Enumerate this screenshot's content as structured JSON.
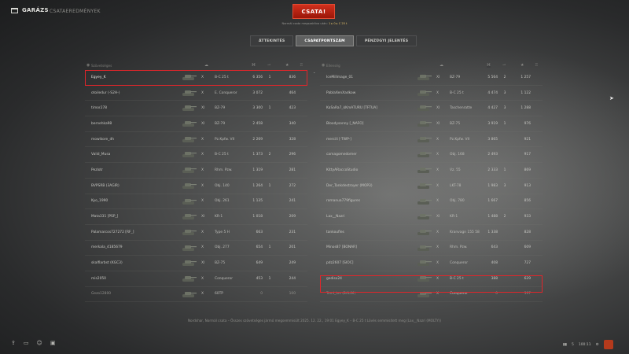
{
  "nav": {
    "garage_label": "GARÁZS",
    "battles_label": "CSATAEREDMÉNYEK"
  },
  "battle_button": "CSATA!",
  "subinfo": {
    "prefix": "Normál csata megszakítva után:",
    "value": "1 ▸ 0 ▸ C 25 t"
  },
  "tabs": [
    "ÁTTEKINTÉS",
    "CSAPATPONTSZÁM",
    "PÉNZÜGYI JELENTÉS"
  ],
  "active_tab": "CSAPATPONTSZÁM",
  "left_team": {
    "header": "Szövetséges",
    "rows": [
      {
        "player": "Egyey_K",
        "tier": "X",
        "tank": "B-C 25 t",
        "c1": "6 356",
        "c2": "1",
        "c3": "836",
        "self": true
      },
      {
        "player": "otoiledur (-S2H-)",
        "tier": "X",
        "tank": "E. Conqueror",
        "c1": "3 072",
        "c2": "",
        "c3": "464"
      },
      {
        "player": "timor278",
        "tier": "XI",
        "tank": "BZ-79",
        "c1": "3 300",
        "c2": "1",
        "c3": "423"
      },
      {
        "player": "bernehka98",
        "tier": "XI",
        "tank": "BZ-79",
        "c1": "2 458",
        "c2": "",
        "c3": "340"
      },
      {
        "player": "mowikore_dh",
        "tier": "X",
        "tank": "Pz.Kpfw. VII",
        "c1": "2 269",
        "c2": "",
        "c3": "328"
      },
      {
        "player": "Valid_Musa",
        "tier": "X",
        "tank": "B-C 25 t",
        "c1": "1 373",
        "c2": "2",
        "c3": "296"
      },
      {
        "player": "Pezlotr",
        "tier": "X",
        "tank": "Rhm. Pzw.",
        "c1": "1 319",
        "c2": "",
        "c3": "281"
      },
      {
        "player": "BVPSRB (3AGIR)",
        "tier": "X",
        "tank": "Obj. 140",
        "c1": "1 264",
        "c2": "1",
        "c3": "272"
      },
      {
        "player": "Kyo_1990",
        "tier": "X",
        "tank": "Obj. 261",
        "c1": "1 135",
        "c2": "",
        "c3": "241"
      },
      {
        "player": "Mata331 [PSP_]",
        "tier": "XI",
        "tank": "KR-1",
        "c1": "1 018",
        "c2": "",
        "c3": "209"
      },
      {
        "player": "Palamarcos727272 [RF_]",
        "tier": "X",
        "tank": "Type 5 H",
        "c1": "663",
        "c2": "",
        "c3": "231"
      },
      {
        "player": "merkala_4185679",
        "tier": "X",
        "tank": "Obj. 277",
        "c1": "654",
        "c2": "1",
        "c3": "201"
      },
      {
        "player": "skalfiarbst (KGC3)",
        "tier": "XI",
        "tank": "BZ-75",
        "c1": "649",
        "c2": "",
        "c3": "249"
      },
      {
        "player": "mis2050",
        "tier": "X",
        "tank": "Conqueror",
        "c1": "453",
        "c2": "1",
        "c3": "244"
      },
      {
        "player": "Gezo12800",
        "tier": "X",
        "tank": "60TP",
        "c1": "0",
        "c2": "",
        "c3": "100",
        "dead": true
      }
    ]
  },
  "right_team": {
    "header": "Ellenség",
    "rows": [
      {
        "player": "IceMillmage_01",
        "tier": "XI",
        "tank": "BZ-79",
        "c1": "5 564",
        "c2": "2",
        "c3": "1 257"
      },
      {
        "player": "PablaXenXadkow",
        "tier": "X",
        "tank": "B-C 25 t",
        "c1": "4 474",
        "c2": "3",
        "c3": "1 122"
      },
      {
        "player": "KaSaRa7_kKmATURU [TFTUA]",
        "tier": "XI",
        "tank": "Taschenratte",
        "c1": "4 427",
        "c2": "3",
        "c3": "1 288"
      },
      {
        "player": "Bloodysonny [_NAFO]",
        "tier": "XI",
        "tank": "BZ-75",
        "c1": "3 919",
        "c2": "1",
        "c3": "976"
      },
      {
        "player": "mercili [-TWP-]",
        "tier": "X",
        "tank": "Pz.Kpfw. VII",
        "c1": "3 865",
        "c2": "",
        "c3": "921"
      },
      {
        "player": "camagomedomer",
        "tier": "X",
        "tank": "Obj. 168",
        "c1": "2 493",
        "c2": "",
        "c3": "917"
      },
      {
        "player": "KittyARaccoStudio",
        "tier": "X",
        "tank": "Vz. 55",
        "c1": "2 333",
        "c2": "1",
        "c3": "869"
      },
      {
        "player": "Der_Tankdestroyer (MOP3)",
        "tier": "X",
        "tank": "LKT-78",
        "c1": "1 983",
        "c2": "3",
        "c3": "913"
      },
      {
        "player": "romanua779figures",
        "tier": "X",
        "tank": "Obj. 780",
        "c1": "1 667",
        "c2": "",
        "c3": "856"
      },
      {
        "player": "Lax__Nazri",
        "tier": "XI",
        "tank": "KR-1",
        "c1": "1 488",
        "c2": "2",
        "c3": "933"
      },
      {
        "player": "tankoufles",
        "tier": "X",
        "tank": "Kranvagn 155 58",
        "c1": "1 338",
        "c2": "",
        "c3": "828"
      },
      {
        "player": "Minos87 [BONAR]",
        "tier": "X",
        "tank": "Rhm. Pzw.",
        "c1": "643",
        "c2": "",
        "c3": "609"
      },
      {
        "player": "pdz2607 [SIOC]",
        "tier": "X",
        "tank": "Conqueror",
        "c1": "408",
        "c2": "",
        "c3": "727"
      },
      {
        "player": "gedisx24",
        "tier": "X",
        "tank": "B-C 25 t",
        "c1": "388",
        "c2": "",
        "c3": "629"
      },
      {
        "player": "Tomi_lov (BALIM)",
        "tier": "X",
        "tank": "Conqueror",
        "c1": "0",
        "c2": "",
        "c3": "597",
        "dead": true
      }
    ]
  },
  "footer": "Nordshar, Normál csata – Összes szövetséges jármű megsemmisült    2025. 12. 22., 19:01    Egyey_K – B-C 25 t    Lövés semmisített meg (Lax__Nazri (MOLTY))",
  "bottom_right": {
    "stat": "5",
    "time": "100:11"
  }
}
